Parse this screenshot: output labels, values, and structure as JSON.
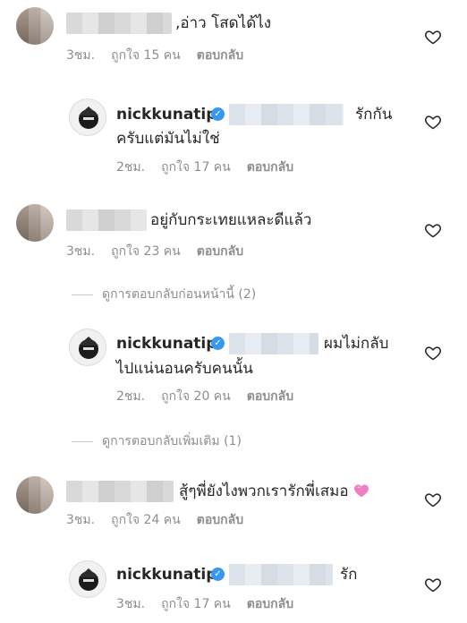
{
  "comments": [
    {
      "text": ",อ่าว โสดได้ไง",
      "time": "3ชม.",
      "likes": "ถูกใจ 15 คน",
      "reply": "ตอบกลับ"
    },
    {
      "username": "nickkunatip",
      "text_line1": "รักกัน",
      "text_line2": "ครับแต่มันไม่ใช่",
      "time": "2ชม.",
      "likes": "ถูกใจ 17 คน",
      "reply": "ตอบกลับ"
    },
    {
      "text": "อยู่กับกระเทยแหละดีแล้ว",
      "time": "3ชม.",
      "likes": "ถูกใจ 23 คน",
      "reply": "ตอบกลับ"
    },
    {
      "username": "nickkunatip",
      "text_line1": "ผมไม่กลับ",
      "text_line2": "ไปแน่นอนครับคนนั้น",
      "time": "2ชม.",
      "likes": "ถูกใจ 20 คน",
      "reply": "ตอบกลับ"
    },
    {
      "text": "สู้ๆพี่ยังไงพวกเรารักพี่เสมอ",
      "time": "3ชม.",
      "likes": "ถูกใจ 24 คน",
      "reply": "ตอบกลับ"
    },
    {
      "username": "nickkunatip",
      "text_line1": "รัก",
      "time": "3ชม.",
      "likes": "ถูกใจ 17 คน",
      "reply": "ตอบกลับ"
    }
  ],
  "view_previous": "ดูการตอบกลับก่อนหน้านี้ (2)",
  "view_more": "ดูการตอบกลับเพิ่มเติม (1)",
  "colors": {
    "verified": "#3897f0",
    "meta": "#8e8e8e",
    "emoji_heart": "#f27ec2"
  },
  "icons": {
    "like": "heart-outline-icon",
    "verified": "verified-badge-icon",
    "emoji": "pink-heart-emoji"
  }
}
